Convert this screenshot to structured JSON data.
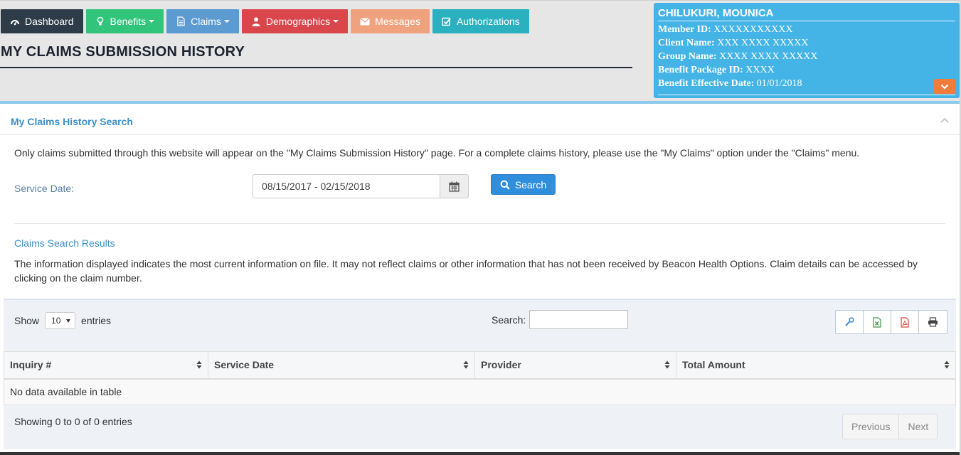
{
  "nav": {
    "dashboard": "Dashboard",
    "benefits": "Benefits",
    "claims": "Claims",
    "demographics": "Demographics",
    "messages": "Messages",
    "authorizations": "Authorizations"
  },
  "page": {
    "title": "MY CLAIMS SUBMISSION HISTORY"
  },
  "member": {
    "name": "CHILUKURI, MOUNICA",
    "member_id_label": "Member ID:",
    "member_id": "XXXXXXXXXXX",
    "client_name_label": "Client Name:",
    "client_name": "XXX XXXX XXXXX",
    "group_name_label": "Group Name:",
    "group_name": "XXXX XXXX XXXXX",
    "benefit_package_label": "Benefit Package ID:",
    "benefit_package": "XXXX",
    "effective_date_label": "Benefit Effective Date:",
    "effective_date": "01/01/2018"
  },
  "panel": {
    "title": "My Claims History Search",
    "intro": "Only claims submitted through this website will appear on the \"My Claims Submission History\" page. For a complete claims history, please use the \"My Claims\" option under the \"Claims\" menu.",
    "service_date_label": "Service Date:",
    "service_date_value": "08/15/2017 - 02/15/2018",
    "search_label": "Search"
  },
  "results": {
    "title": "Claims Search Results",
    "info": "The information displayed indicates the most current information on file. It may not reflect claims or other information that has not been received by Beacon Health Options. Claim details can be accessed by clicking on the claim number."
  },
  "table": {
    "show_label": "Show",
    "entries_label": "entries",
    "page_length": "10",
    "search_label": "Search:",
    "columns": [
      "Inquiry #",
      "Service Date",
      "Provider",
      "Total Amount"
    ],
    "empty_message": "No data available in table",
    "showing": "Showing 0 to 0 of 0 entries",
    "prev_label": "Previous",
    "next_label": "Next"
  },
  "colors": {
    "card_blue": "#44b4e6",
    "accent_orange": "#f07c3c",
    "link_blue": "#3a8fc8"
  }
}
